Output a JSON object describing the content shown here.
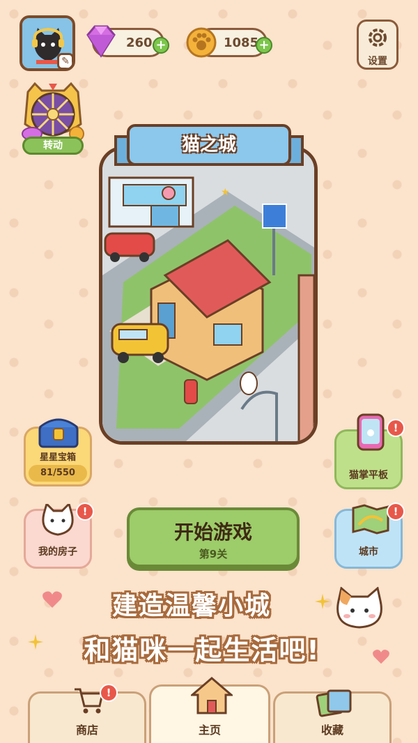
{
  "header": {
    "gems": "260",
    "coins": "1085",
    "settings_label": "设置"
  },
  "wheel": {
    "label": "转动"
  },
  "city": {
    "title": "猫之城"
  },
  "side": {
    "chest_label": "星星宝箱",
    "chest_progress": "81/550",
    "tablet_label": "猫掌平板",
    "house_label": "我的房子",
    "city_label": "城市"
  },
  "start": {
    "label": "开始游戏",
    "level": "第9关"
  },
  "slogan": {
    "line1": "建造温馨小城",
    "line2": "和猫咪一起生活吧!"
  },
  "nav": {
    "shop": "商店",
    "home": "主页",
    "collection": "收藏"
  },
  "badge": "!",
  "colors": {
    "background": "#fbe3cc",
    "accent_green": "#9dcc6a",
    "banner_blue": "#8cc7ec",
    "badge_red": "#e8584a",
    "outline_brown": "#6a3f25"
  }
}
